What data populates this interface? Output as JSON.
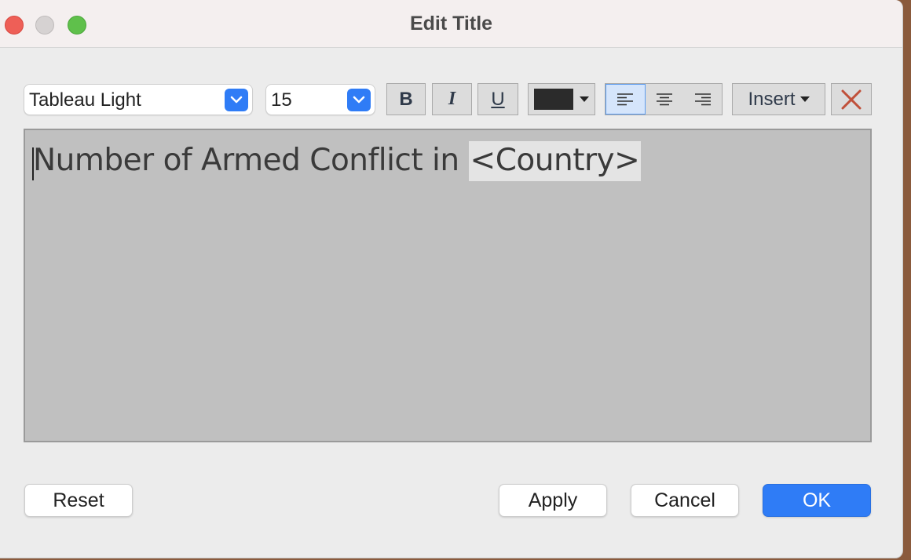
{
  "window": {
    "title": "Edit Title"
  },
  "toolbar": {
    "font_family": "Tableau Light",
    "font_size": "15",
    "bold_label": "B",
    "italic_label": "I",
    "underline_label": "U",
    "text_color": "#2b2b2b",
    "alignment_selected": "left",
    "insert_label": "Insert"
  },
  "editor": {
    "text": "Number of Armed Conflict in ",
    "field": "<Country>"
  },
  "buttons": {
    "reset": "Reset",
    "apply": "Apply",
    "cancel": "Cancel",
    "ok": "OK"
  }
}
